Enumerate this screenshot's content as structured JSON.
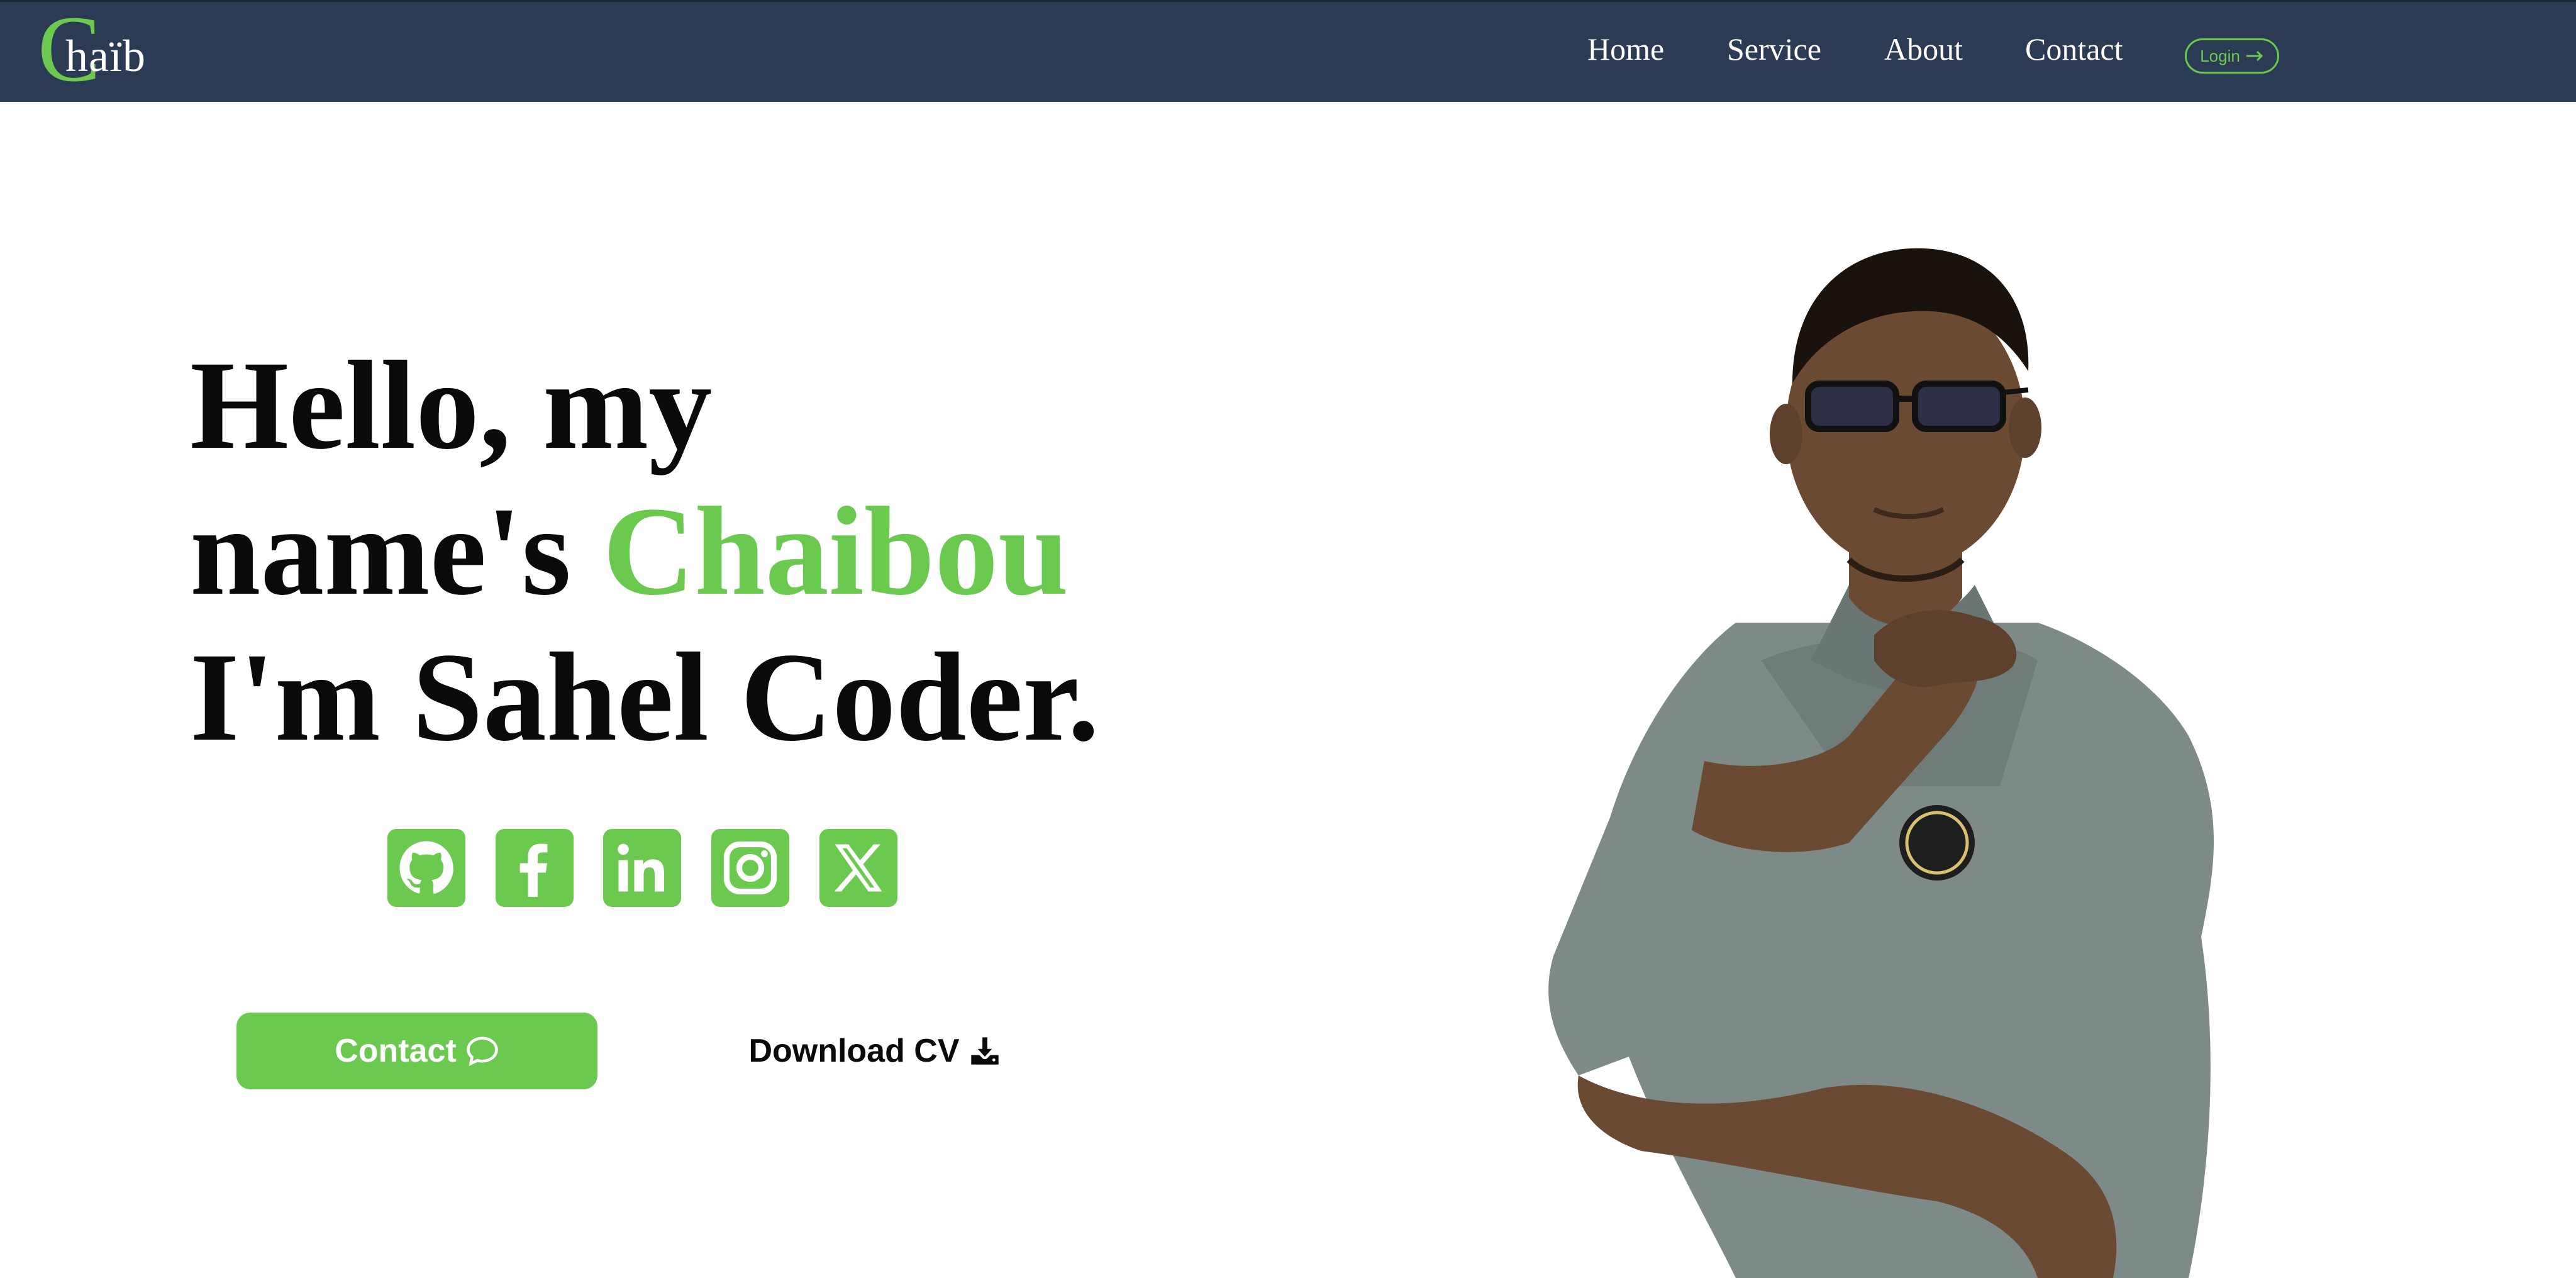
{
  "nav": {
    "logo_initial": "C",
    "logo_rest": "haïb",
    "links": [
      "Home",
      "Service",
      "About",
      "Contact"
    ],
    "login_label": "Login"
  },
  "hero": {
    "line1": "Hello, my",
    "line2_prefix": "name's ",
    "line2_name": "Chaibou",
    "line3": "I'm Sahel Coder."
  },
  "social": [
    {
      "icon": "github-icon"
    },
    {
      "icon": "facebook-icon"
    },
    {
      "icon": "linkedin-icon"
    },
    {
      "icon": "instagram-icon"
    },
    {
      "icon": "x-icon"
    }
  ],
  "buttons": {
    "contact_label": "Contact",
    "contact_icon": "chat-bubble-icon",
    "cv_label": "Download CV",
    "cv_icon": "download-icon"
  },
  "colors": {
    "navbar": "#2b3b53",
    "accent": "#6cc94f",
    "text": "#0a0a0a",
    "background": "#ffffff"
  }
}
